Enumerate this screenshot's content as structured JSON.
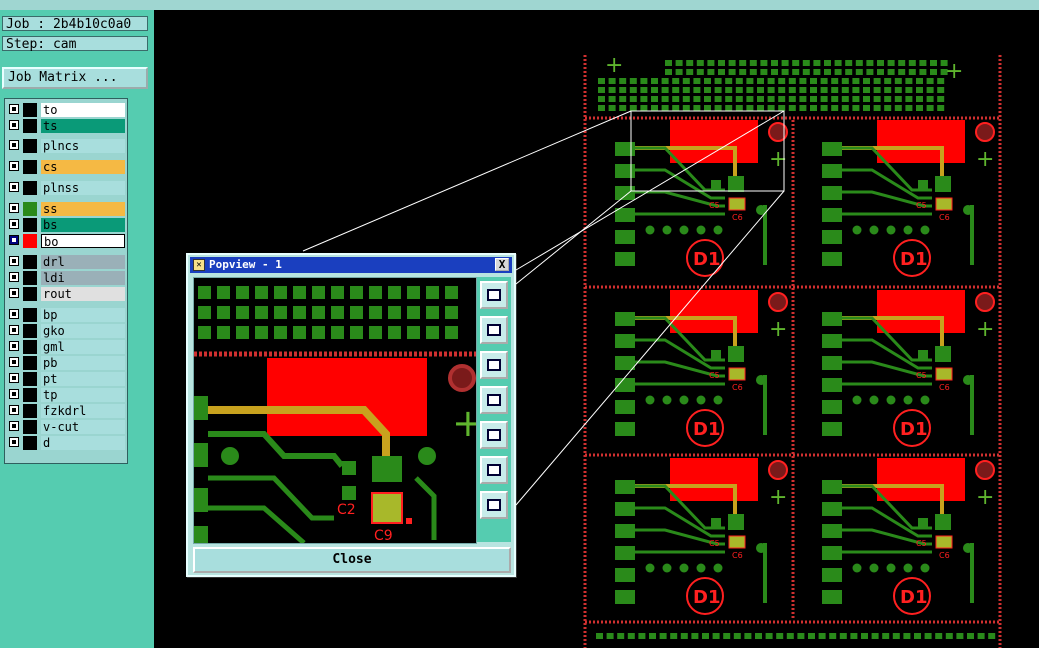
{
  "job": {
    "label": "Job : 2b4b10c0a0",
    "step": "Step: cam"
  },
  "matrix_button": "Job Matrix ...",
  "layers": [
    {
      "name": "to",
      "color": "#ffffff",
      "swatch": "#000000",
      "checked": false
    },
    {
      "name": "ts",
      "color": "#0a9a78",
      "swatch": "#000000",
      "checked": false
    },
    {
      "name": "plncs",
      "color": "#a8dedd",
      "swatch": "#000000",
      "checked": false
    },
    {
      "name": "cs",
      "color": "#f5b944",
      "swatch": "#000000",
      "checked": false
    },
    {
      "name": "plnss",
      "color": "#a8dedd",
      "swatch": "#000000",
      "checked": false
    },
    {
      "name": "ss",
      "color": "#f5b944",
      "swatch": "#2a8a1a",
      "checked": false
    },
    {
      "name": "bs",
      "color": "#0a9a78",
      "swatch": "#000000",
      "checked": false
    },
    {
      "name": "bo",
      "color": "#ffffff",
      "swatch": "#ff0000",
      "checked": true
    },
    {
      "name": "drl",
      "color": "#9ab0b8",
      "swatch": "#000000",
      "checked": false
    },
    {
      "name": "ldi",
      "color": "#9ab0b8",
      "swatch": "#000000",
      "checked": false
    },
    {
      "name": "rout",
      "color": "#e0e0e0",
      "swatch": "#000000",
      "checked": false
    },
    {
      "name": "bp",
      "color": "#a8dedd",
      "swatch": "#000000",
      "checked": false
    },
    {
      "name": "gko",
      "color": "#a8dedd",
      "swatch": "#000000",
      "checked": false
    },
    {
      "name": "gml",
      "color": "#a8dedd",
      "swatch": "#000000",
      "checked": false
    },
    {
      "name": "pb",
      "color": "#a8dedd",
      "swatch": "#000000",
      "checked": false
    },
    {
      "name": "pt",
      "color": "#a8dedd",
      "swatch": "#000000",
      "checked": false
    },
    {
      "name": "tp",
      "color": "#a8dedd",
      "swatch": "#000000",
      "checked": false
    },
    {
      "name": "fzkdrl",
      "color": "#a8dedd",
      "swatch": "#000000",
      "checked": false
    },
    {
      "name": "v-cut",
      "color": "#a8dedd",
      "swatch": "#000000",
      "checked": false
    },
    {
      "name": "d",
      "color": "#a8dedd",
      "swatch": "#000000",
      "checked": false
    }
  ],
  "popview": {
    "title": "Popview - 1",
    "close_x": "X",
    "close_button": "Close",
    "labels": {
      "c2": "C2",
      "c9": "C9"
    },
    "tool_icons": [
      "zoom-fit-icon",
      "pan-up-icon",
      "pan-down-icon",
      "pan-left-icon",
      "pan-right-icon",
      "zoom-in-icon",
      "zoom-out-icon"
    ]
  },
  "board": {
    "component_labels": [
      "C5",
      "C6",
      "D1"
    ],
    "colors": {
      "copper": "#2a8a1a",
      "pad_red": "#ff0000",
      "silk": "#ff2020",
      "trace": "#c8a21e",
      "cross": "#5fb52e"
    }
  }
}
